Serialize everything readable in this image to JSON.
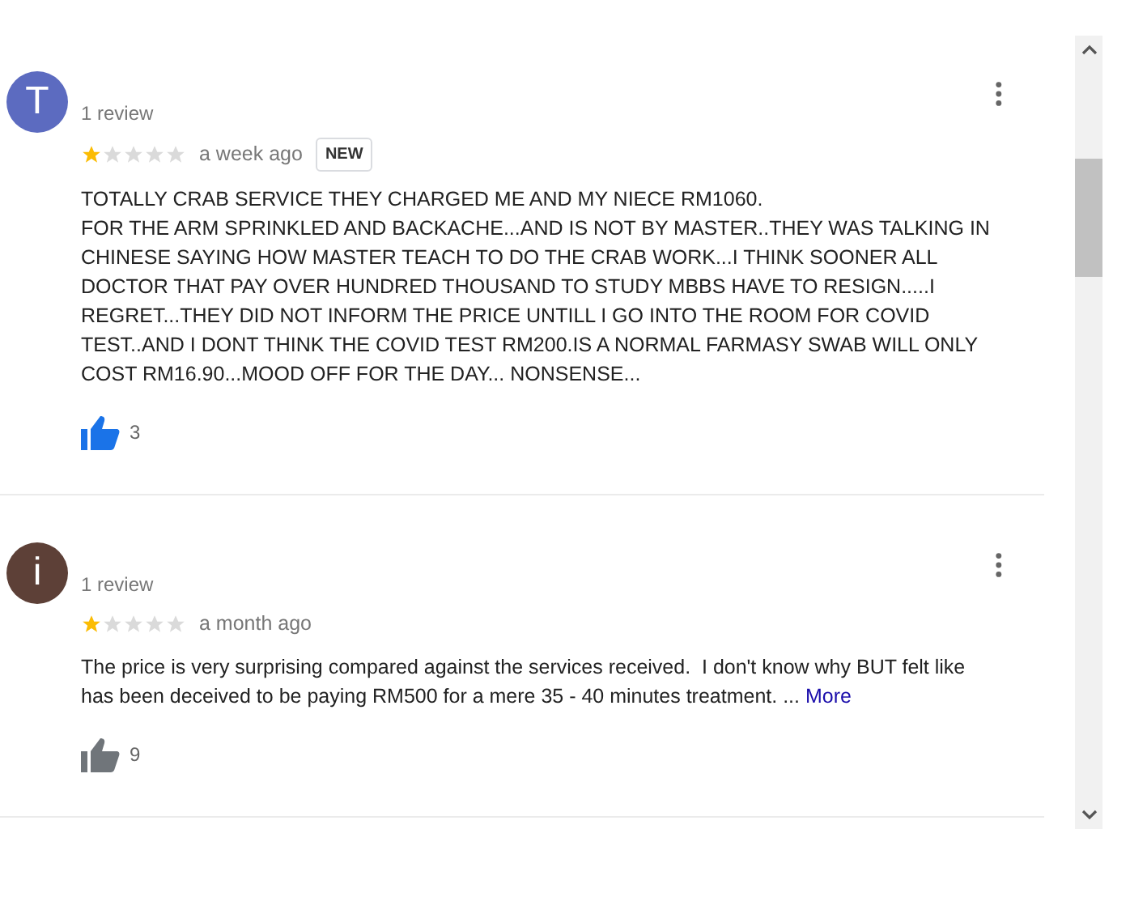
{
  "reviews": [
    {
      "avatar_letter": "T",
      "color": "#5c6bc0",
      "review_count": "1 review",
      "stars": 1,
      "time": "a week ago",
      "badge": "NEW",
      "text": "TOTALLY CRAB SERVICE THEY CHARGED ME AND MY NIECE RM1060.\nFOR THE ARM SPRINKLED AND BACKACHE...AND IS NOT BY MASTER..THEY WAS TALKING IN CHINESE SAYING HOW MASTER TEACH TO DO THE CRAB WORK...I THINK SOONER ALL DOCTOR THAT PAY OVER HUNDRED THOUSAND TO STUDY MBBS HAVE TO RESIGN.....I REGRET...THEY DID NOT INFORM THE PRICE UNTILL I GO INTO THE ROOM FOR COVID TEST..AND I DONT THINK THE COVID TEST RM200.IS A NORMAL FARMASY SWAB WILL ONLY COST RM16.90...MOOD OFF FOR THE DAY... NONSENSE...",
      "liked": true,
      "likes": "3"
    },
    {
      "avatar_letter": "i",
      "color": "#5d4037",
      "review_count": "1 review",
      "stars": 1,
      "time": "a month ago",
      "text": "The price is very surprising compared against the services received.  I don't know why BUT felt like has been deceived to be paying RM500 for a mere 35 - 40 minutes treatment. ...",
      "more": "More",
      "liked": false,
      "likes": "9"
    }
  ]
}
